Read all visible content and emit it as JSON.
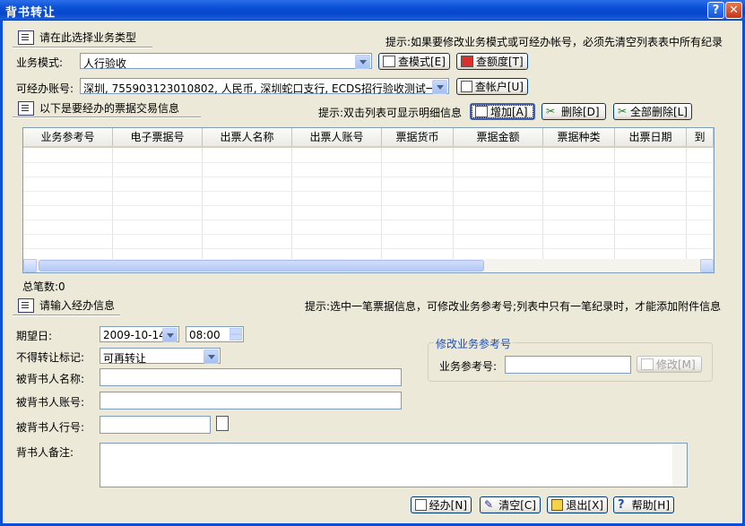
{
  "window": {
    "title": "背书转让",
    "help_btn": "?",
    "close_btn": "✕"
  },
  "section1": {
    "title": "请在此选择业务类型",
    "hint": "提示:如果要修改业务模式或可经办帐号，必须先清空列表表中所有纪录",
    "biz_mode_label": "业务模式:",
    "biz_mode_value": "人行验收",
    "btn_query_mode": "查模式[E]",
    "btn_query_limit": "查额度[T]",
    "account_label": "可经办账号:",
    "account_value": "深圳, 755903123010802, 人民币, 深圳蛇口支行, ECDS招行验收测试一",
    "btn_query_account": "查帐户[U]"
  },
  "section2": {
    "title": "以下是要经办的票据交易信息",
    "hint": "提示:双击列表可显示明细信息",
    "btn_add": "增加[A]",
    "btn_delete": "删除[D]",
    "btn_delete_all": "全部删除[L]",
    "columns": [
      "业务参考号",
      "电子票据号",
      "出票人名称",
      "出票人账号",
      "票据货币",
      "票据金额",
      "票据种类",
      "出票日期",
      "到"
    ],
    "total_label": "总笔数:0"
  },
  "section3": {
    "title": "请输入经办信息",
    "hint": "提示:选中一笔票据信息，可修改业务参考号;列表中只有一笔纪录时，才能添加附件信息",
    "date_label": "期望日:",
    "date_value": "2009-10-14",
    "time_value": "08:00",
    "nontransfer_label": "不得转让标记:",
    "nontransfer_value": "可再转让",
    "endorsee_name_label": "被背书人名称:",
    "endorsee_account_label": "被背书人账号:",
    "endorsee_bank_label": "被背书人行号:",
    "memo_label": "背书人备注:",
    "modify_group_title": "修改业务参考号",
    "ref_no_label": "业务参考号:",
    "btn_modify": "修改[M]"
  },
  "footer": {
    "btn_submit": "经办[N]",
    "btn_clear": "清空[C]",
    "btn_exit": "退出[X]",
    "btn_help": "帮助[H]"
  }
}
